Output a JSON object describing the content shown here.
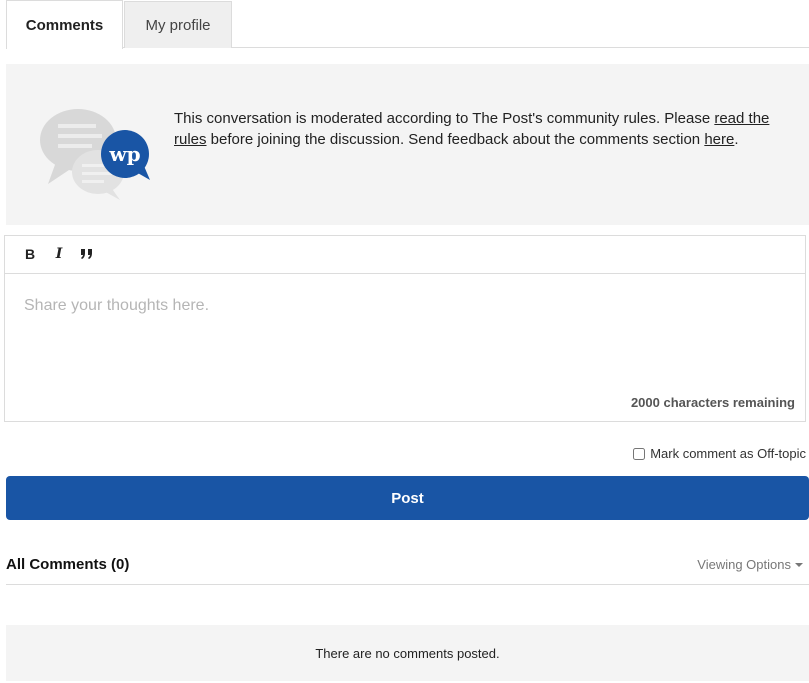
{
  "tabs": [
    {
      "label": "Comments",
      "active": true
    },
    {
      "label": "My profile",
      "active": false
    }
  ],
  "notice": {
    "text_before": "This conversation is moderated according to The Post's community rules. Please ",
    "rules_link": "read the rules",
    "text_middle": " before joining the discussion. Send feedback about the comments section ",
    "feedback_link": "here",
    "text_after": ".",
    "icon_badge": "wp",
    "icon_name": "speech-bubbles-icon"
  },
  "editor": {
    "toolbar": {
      "bold_label": "B",
      "italic_label": "I",
      "quote_label": "❞"
    },
    "placeholder": "Share your thoughts here.",
    "char_count": "2000 characters remaining"
  },
  "offtopic": {
    "label": "Mark comment as Off-topic",
    "checked": false
  },
  "post_button": {
    "label": "Post"
  },
  "comments": {
    "header": "All Comments (0)",
    "viewing_options": "Viewing Options",
    "empty_message": "There are no comments posted."
  },
  "colors": {
    "accent": "#1955a5",
    "panel_bg": "#f4f4f4",
    "border": "#dcdcdc",
    "bubble_gray": "#d8d8d8"
  }
}
